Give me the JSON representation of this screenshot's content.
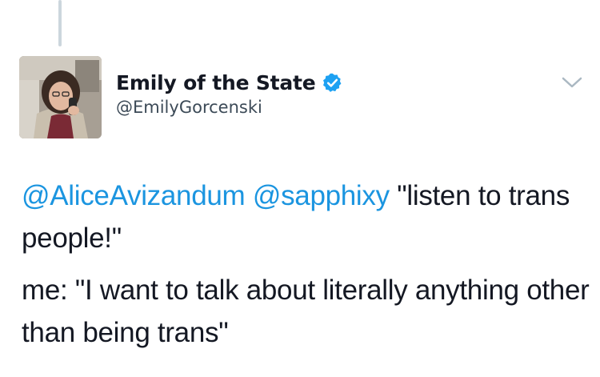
{
  "tweet": {
    "author": {
      "display_name": "Emily of the State",
      "handle": "@EmilyGorcenski",
      "verified": true,
      "avatar_icon": "profile-photo"
    },
    "mentions": [
      "@AliceAvizandum",
      "@sapphixy"
    ],
    "line1_rest": " \"listen to trans people!\"",
    "line2": "me: \"I want to talk about literally anything other than being trans\"",
    "menu_icon": "chevron-down-icon"
  },
  "colors": {
    "mention": "#1b95e0",
    "verified_badge": "#1da1f2",
    "thread_line": "#ccd6dd",
    "text": "#141823"
  }
}
